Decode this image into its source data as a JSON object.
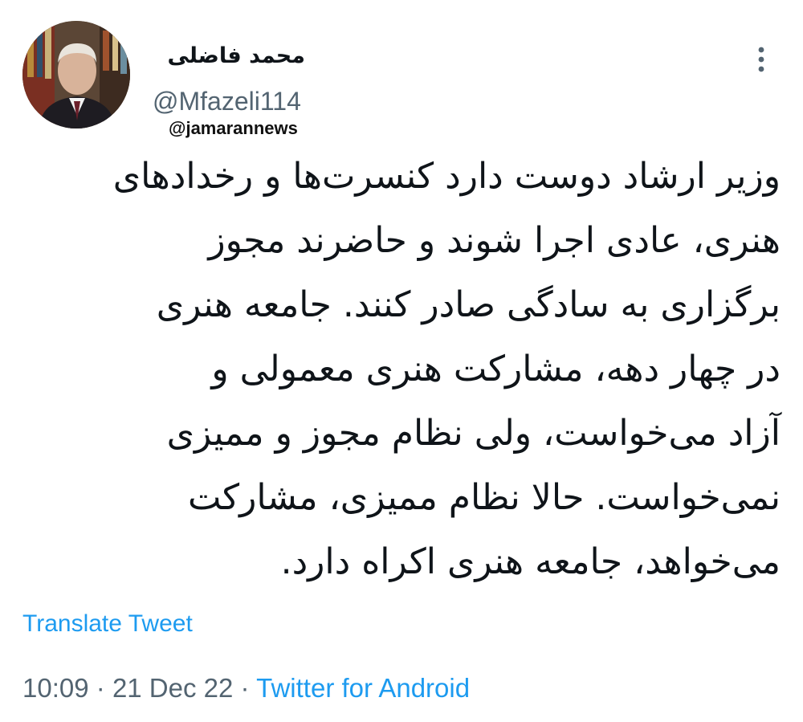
{
  "author": {
    "display_name": "محمد فاضلی",
    "handle": "@Mfazeli114"
  },
  "watermark": "@jamarannews",
  "tweet": {
    "lines": [
      "وزیر ارشاد دوست دارد کنسرت‌ها و رخدادهای",
      "هنری، عادی اجرا شوند و حاضرند مجوز",
      "برگزاری به سادگی صادر کنند. جامعه هنری",
      "در چهار دهه، مشارکت هنری معمولی و",
      "آزاد می‌خواست، ولی نظام مجوز و ممیزی",
      "نمی‌خواست. حالا نظام ممیزی، مشارکت",
      "می‌خواهد، جامعه هنری اکراه دارد."
    ]
  },
  "translate_label": "Translate Tweet",
  "meta": {
    "time": "10:09",
    "separator": "·",
    "date": "21 Dec 22",
    "source": "Twitter for Android"
  },
  "icons": {
    "more": "more-vertical-icon",
    "avatar": "profile-photo"
  },
  "colors": {
    "text": "#0f1419",
    "secondary": "#536471",
    "link": "#1d9bf0",
    "background": "#ffffff"
  }
}
